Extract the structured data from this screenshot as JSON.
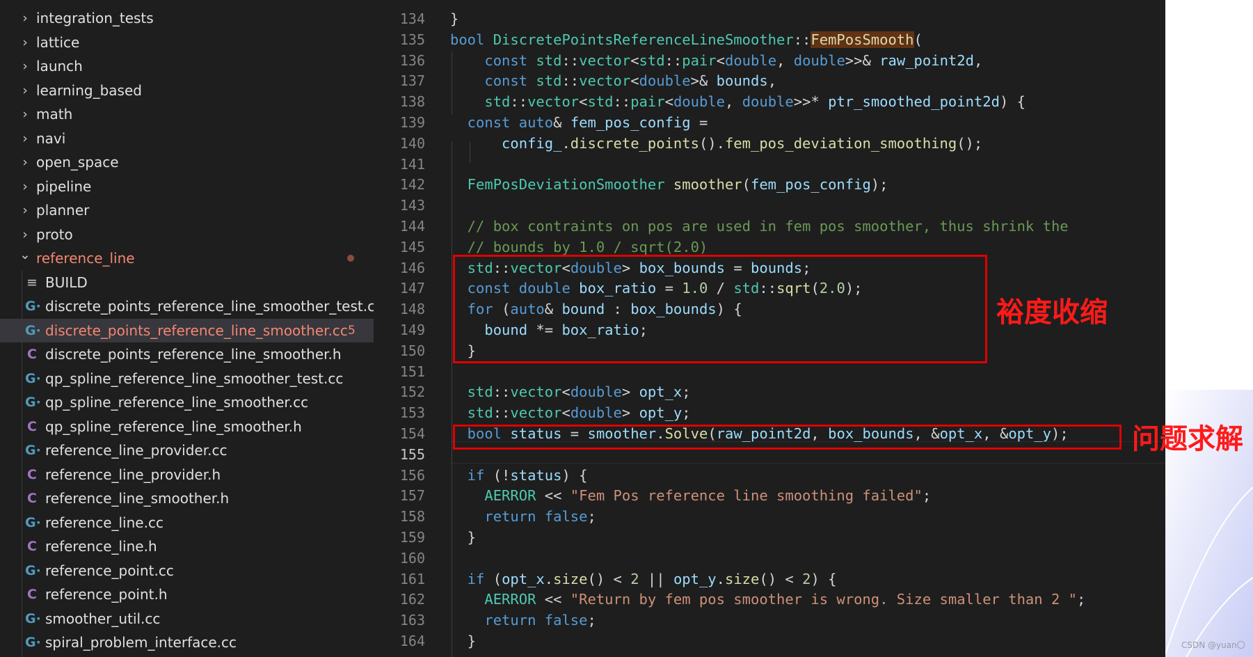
{
  "sidebar": {
    "folders": [
      {
        "label": "integration_tests"
      },
      {
        "label": "lattice"
      },
      {
        "label": "launch"
      },
      {
        "label": "learning_based"
      },
      {
        "label": "math"
      },
      {
        "label": "navi"
      },
      {
        "label": "open_space"
      },
      {
        "label": "pipeline"
      },
      {
        "label": "planner"
      },
      {
        "label": "proto"
      }
    ],
    "open_folder": {
      "label": "reference_line"
    },
    "files": [
      {
        "icon": "build",
        "glyph": "≡",
        "label": "BUILD"
      },
      {
        "icon": "cc",
        "glyph": "G·",
        "label": "discrete_points_reference_line_smoother_test.cc"
      },
      {
        "icon": "cc",
        "glyph": "G·",
        "label": "discrete_points_reference_line_smoother.cc",
        "selected": true,
        "badge": "5"
      },
      {
        "icon": "h",
        "glyph": "C",
        "label": "discrete_points_reference_line_smoother.h"
      },
      {
        "icon": "cc",
        "glyph": "G·",
        "label": "qp_spline_reference_line_smoother_test.cc"
      },
      {
        "icon": "cc",
        "glyph": "G·",
        "label": "qp_spline_reference_line_smoother.cc"
      },
      {
        "icon": "h",
        "glyph": "C",
        "label": "qp_spline_reference_line_smoother.h"
      },
      {
        "icon": "cc",
        "glyph": "G·",
        "label": "reference_line_provider.cc"
      },
      {
        "icon": "h",
        "glyph": "C",
        "label": "reference_line_provider.h"
      },
      {
        "icon": "h",
        "glyph": "C",
        "label": "reference_line_smoother.h"
      },
      {
        "icon": "cc",
        "glyph": "G·",
        "label": "reference_line.cc"
      },
      {
        "icon": "h",
        "glyph": "C",
        "label": "reference_line.h"
      },
      {
        "icon": "cc",
        "glyph": "G·",
        "label": "reference_point.cc"
      },
      {
        "icon": "h",
        "glyph": "C",
        "label": "reference_point.h"
      },
      {
        "icon": "cc",
        "glyph": "G·",
        "label": "smoother_util.cc"
      },
      {
        "icon": "cc",
        "glyph": "G·",
        "label": "spiral_problem_interface.cc"
      }
    ]
  },
  "editor": {
    "active_line": "155",
    "lines": [
      {
        "n": "134",
        "tokens": [
          {
            "t": "}",
            "c": ""
          }
        ]
      },
      {
        "n": "135",
        "tokens": [
          {
            "t": "bool ",
            "c": "kw"
          },
          {
            "t": "DiscretePointsReferenceLineSmoother",
            "c": "ty"
          },
          {
            "t": "::",
            "c": ""
          },
          {
            "t": "FemPosSmooth",
            "c": "fn hl"
          },
          {
            "t": "(",
            "c": ""
          }
        ]
      },
      {
        "n": "136",
        "tokens": [
          {
            "t": "    const ",
            "c": "kw"
          },
          {
            "t": "std",
            "c": "ty"
          },
          {
            "t": "::",
            "c": ""
          },
          {
            "t": "vector",
            "c": "ty"
          },
          {
            "t": "<",
            "c": ""
          },
          {
            "t": "std",
            "c": "ty"
          },
          {
            "t": "::",
            "c": ""
          },
          {
            "t": "pair",
            "c": "ty"
          },
          {
            "t": "<",
            "c": ""
          },
          {
            "t": "double",
            "c": "kw"
          },
          {
            "t": ", ",
            "c": ""
          },
          {
            "t": "double",
            "c": "kw"
          },
          {
            "t": ">>& ",
            "c": ""
          },
          {
            "t": "raw_point2d",
            "c": "var"
          },
          {
            "t": ",",
            "c": ""
          }
        ]
      },
      {
        "n": "137",
        "tokens": [
          {
            "t": "    const ",
            "c": "kw"
          },
          {
            "t": "std",
            "c": "ty"
          },
          {
            "t": "::",
            "c": ""
          },
          {
            "t": "vector",
            "c": "ty"
          },
          {
            "t": "<",
            "c": ""
          },
          {
            "t": "double",
            "c": "kw"
          },
          {
            "t": ">& ",
            "c": ""
          },
          {
            "t": "bounds",
            "c": "var"
          },
          {
            "t": ",",
            "c": ""
          }
        ]
      },
      {
        "n": "138",
        "tokens": [
          {
            "t": "    std",
            "c": "ty"
          },
          {
            "t": "::",
            "c": ""
          },
          {
            "t": "vector",
            "c": "ty"
          },
          {
            "t": "<",
            "c": ""
          },
          {
            "t": "std",
            "c": "ty"
          },
          {
            "t": "::",
            "c": ""
          },
          {
            "t": "pair",
            "c": "ty"
          },
          {
            "t": "<",
            "c": ""
          },
          {
            "t": "double",
            "c": "kw"
          },
          {
            "t": ", ",
            "c": ""
          },
          {
            "t": "double",
            "c": "kw"
          },
          {
            "t": ">>* ",
            "c": ""
          },
          {
            "t": "ptr_smoothed_point2d",
            "c": "var"
          },
          {
            "t": ") {",
            "c": ""
          }
        ]
      },
      {
        "n": "139",
        "tokens": [
          {
            "t": "  const ",
            "c": "kw"
          },
          {
            "t": "auto",
            "c": "kw"
          },
          {
            "t": "& ",
            "c": ""
          },
          {
            "t": "fem_pos_config",
            "c": "var"
          },
          {
            "t": " =",
            "c": ""
          }
        ]
      },
      {
        "n": "140",
        "tokens": [
          {
            "t": "      config_",
            "c": "var"
          },
          {
            "t": ".",
            "c": ""
          },
          {
            "t": "discrete_points",
            "c": "fn"
          },
          {
            "t": "().",
            "c": ""
          },
          {
            "t": "fem_pos_deviation_smoothing",
            "c": "fn"
          },
          {
            "t": "();",
            "c": ""
          }
        ]
      },
      {
        "n": "141",
        "tokens": []
      },
      {
        "n": "142",
        "tokens": [
          {
            "t": "  FemPosDeviationSmoother ",
            "c": "ty"
          },
          {
            "t": "smoother",
            "c": "fn"
          },
          {
            "t": "(",
            "c": ""
          },
          {
            "t": "fem_pos_config",
            "c": "var"
          },
          {
            "t": ");",
            "c": ""
          }
        ]
      },
      {
        "n": "143",
        "tokens": []
      },
      {
        "n": "144",
        "tokens": [
          {
            "t": "  // box contraints on pos are used in fem pos smoother, thus shrink the",
            "c": "cm"
          }
        ]
      },
      {
        "n": "145",
        "tokens": [
          {
            "t": "  // bounds by 1.0 / sqrt(2.0)",
            "c": "cm"
          }
        ]
      },
      {
        "n": "146",
        "tokens": [
          {
            "t": "  std",
            "c": "ty"
          },
          {
            "t": "::",
            "c": ""
          },
          {
            "t": "vector",
            "c": "ty"
          },
          {
            "t": "<",
            "c": ""
          },
          {
            "t": "double",
            "c": "kw"
          },
          {
            "t": "> ",
            "c": ""
          },
          {
            "t": "box_bounds",
            "c": "var"
          },
          {
            "t": " = ",
            "c": ""
          },
          {
            "t": "bounds",
            "c": "var"
          },
          {
            "t": ";",
            "c": ""
          }
        ]
      },
      {
        "n": "147",
        "tokens": [
          {
            "t": "  const ",
            "c": "kw"
          },
          {
            "t": "double ",
            "c": "kw"
          },
          {
            "t": "box_ratio",
            "c": "var"
          },
          {
            "t": " = ",
            "c": ""
          },
          {
            "t": "1.0",
            "c": "num"
          },
          {
            "t": " / ",
            "c": ""
          },
          {
            "t": "std",
            "c": "ty"
          },
          {
            "t": "::",
            "c": ""
          },
          {
            "t": "sqrt",
            "c": "fn"
          },
          {
            "t": "(",
            "c": ""
          },
          {
            "t": "2.0",
            "c": "num"
          },
          {
            "t": ");",
            "c": ""
          }
        ]
      },
      {
        "n": "148",
        "tokens": [
          {
            "t": "  for ",
            "c": "kw"
          },
          {
            "t": "(",
            "c": ""
          },
          {
            "t": "auto",
            "c": "kw"
          },
          {
            "t": "& ",
            "c": ""
          },
          {
            "t": "bound",
            "c": "var"
          },
          {
            "t": " : ",
            "c": ""
          },
          {
            "t": "box_bounds",
            "c": "var"
          },
          {
            "t": ") {",
            "c": ""
          }
        ]
      },
      {
        "n": "149",
        "tokens": [
          {
            "t": "    bound",
            "c": "var"
          },
          {
            "t": " *= ",
            "c": ""
          },
          {
            "t": "box_ratio",
            "c": "var"
          },
          {
            "t": ";",
            "c": ""
          }
        ]
      },
      {
        "n": "150",
        "tokens": [
          {
            "t": "  }",
            "c": ""
          }
        ]
      },
      {
        "n": "151",
        "tokens": []
      },
      {
        "n": "152",
        "tokens": [
          {
            "t": "  std",
            "c": "ty"
          },
          {
            "t": "::",
            "c": ""
          },
          {
            "t": "vector",
            "c": "ty"
          },
          {
            "t": "<",
            "c": ""
          },
          {
            "t": "double",
            "c": "kw"
          },
          {
            "t": "> ",
            "c": ""
          },
          {
            "t": "opt_x",
            "c": "var"
          },
          {
            "t": ";",
            "c": ""
          }
        ]
      },
      {
        "n": "153",
        "tokens": [
          {
            "t": "  std",
            "c": "ty"
          },
          {
            "t": "::",
            "c": ""
          },
          {
            "t": "vector",
            "c": "ty"
          },
          {
            "t": "<",
            "c": ""
          },
          {
            "t": "double",
            "c": "kw"
          },
          {
            "t": "> ",
            "c": ""
          },
          {
            "t": "opt_y",
            "c": "var"
          },
          {
            "t": ";",
            "c": ""
          }
        ]
      },
      {
        "n": "154",
        "tokens": [
          {
            "t": "  bool ",
            "c": "kw"
          },
          {
            "t": "status",
            "c": "var"
          },
          {
            "t": " = ",
            "c": ""
          },
          {
            "t": "smoother",
            "c": "var"
          },
          {
            "t": ".",
            "c": ""
          },
          {
            "t": "Solve",
            "c": "fn"
          },
          {
            "t": "(",
            "c": ""
          },
          {
            "t": "raw_point2d",
            "c": "var"
          },
          {
            "t": ", ",
            "c": ""
          },
          {
            "t": "box_bounds",
            "c": "var"
          },
          {
            "t": ", &",
            "c": ""
          },
          {
            "t": "opt_x",
            "c": "var"
          },
          {
            "t": ", &",
            "c": ""
          },
          {
            "t": "opt_y",
            "c": "var"
          },
          {
            "t": ");",
            "c": ""
          }
        ]
      },
      {
        "n": "155",
        "tokens": []
      },
      {
        "n": "156",
        "tokens": [
          {
            "t": "  if ",
            "c": "kw"
          },
          {
            "t": "(!",
            "c": ""
          },
          {
            "t": "status",
            "c": "var"
          },
          {
            "t": ") {",
            "c": ""
          }
        ]
      },
      {
        "n": "157",
        "tokens": [
          {
            "t": "    AERROR",
            "c": "ty"
          },
          {
            "t": " << ",
            "c": ""
          },
          {
            "t": "\"Fem Pos reference line smoothing failed\"",
            "c": "str"
          },
          {
            "t": ";",
            "c": ""
          }
        ]
      },
      {
        "n": "158",
        "tokens": [
          {
            "t": "    return ",
            "c": "kw"
          },
          {
            "t": "false",
            "c": "kw"
          },
          {
            "t": ";",
            "c": ""
          }
        ]
      },
      {
        "n": "159",
        "tokens": [
          {
            "t": "  }",
            "c": ""
          }
        ]
      },
      {
        "n": "160",
        "tokens": []
      },
      {
        "n": "161",
        "tokens": [
          {
            "t": "  if ",
            "c": "kw"
          },
          {
            "t": "(",
            "c": ""
          },
          {
            "t": "opt_x",
            "c": "var"
          },
          {
            "t": ".",
            "c": ""
          },
          {
            "t": "size",
            "c": "fn"
          },
          {
            "t": "() < ",
            "c": ""
          },
          {
            "t": "2",
            "c": "num"
          },
          {
            "t": " || ",
            "c": ""
          },
          {
            "t": "opt_y",
            "c": "var"
          },
          {
            "t": ".",
            "c": ""
          },
          {
            "t": "size",
            "c": "fn"
          },
          {
            "t": "() < ",
            "c": ""
          },
          {
            "t": "2",
            "c": "num"
          },
          {
            "t": ") {",
            "c": ""
          }
        ]
      },
      {
        "n": "162",
        "tokens": [
          {
            "t": "    AERROR",
            "c": "ty"
          },
          {
            "t": " << ",
            "c": ""
          },
          {
            "t": "\"Return by fem pos smoother is wrong. Size smaller than 2 \"",
            "c": "str"
          },
          {
            "t": ";",
            "c": ""
          }
        ]
      },
      {
        "n": "163",
        "tokens": [
          {
            "t": "    return ",
            "c": "kw"
          },
          {
            "t": "false",
            "c": "kw"
          },
          {
            "t": ";",
            "c": ""
          }
        ]
      },
      {
        "n": "164",
        "tokens": [
          {
            "t": "  }",
            "c": ""
          }
        ]
      }
    ]
  },
  "annotations": {
    "box1_label": "裕度收缩",
    "box2_label": "问题求解",
    "color": "#ff1a1a"
  },
  "watermark": "CSDN @yuan〇"
}
